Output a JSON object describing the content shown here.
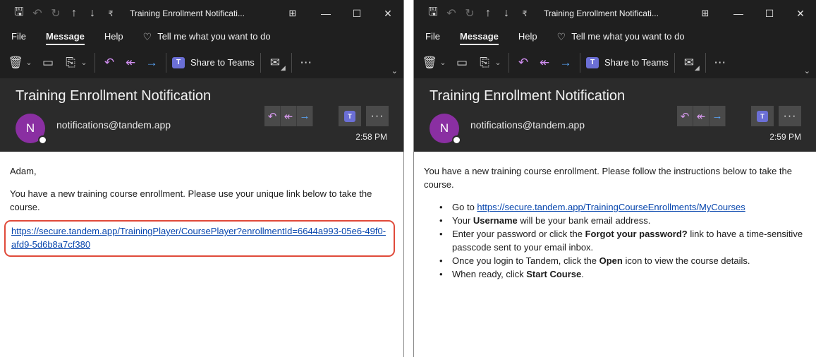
{
  "left": {
    "window_title": "Training Enrollment Notificati...",
    "menu": {
      "file": "File",
      "message": "Message",
      "help": "Help",
      "tellme": "Tell me what you want to do"
    },
    "ribbon": {
      "share_teams": "Share to Teams"
    },
    "subject": "Training Enrollment Notification",
    "avatar_initial": "N",
    "sender": "notifications@tandem.app",
    "time": "2:58 PM",
    "body": {
      "greeting": "Adam,",
      "paragraph": "You have a new training course enrollment. Please use your unique link below to take the course.",
      "link": "https://secure.tandem.app/TrainingPlayer/CoursePlayer?enrollmentId=6644a993-05e6-49f0-afd9-5d6b8a7cf380"
    }
  },
  "right": {
    "window_title": "Training Enrollment Notificati...",
    "menu": {
      "file": "File",
      "message": "Message",
      "help": "Help",
      "tellme": "Tell me what you want to do"
    },
    "ribbon": {
      "share_teams": "Share to Teams"
    },
    "subject": "Training Enrollment Notification",
    "avatar_initial": "N",
    "sender": "notifications@tandem.app",
    "time": "2:59 PM",
    "body": {
      "paragraph": "You have a new training course enrollment. Please follow the instructions below to take the course.",
      "step1_prefix": "Go to ",
      "step1_link": "https://secure.tandem.app/TrainingCourseEnrollments/MyCourses",
      "step2_prefix": "Your ",
      "step2_bold": "Username",
      "step2_suffix": " will be your bank email address.",
      "step3_prefix": "Enter your password or click the ",
      "step3_bold": "Forgot your password?",
      "step3_suffix": " link to have a time-sensitive passcode sent to your email inbox.",
      "step4_prefix": "Once you login to Tandem, click the ",
      "step4_bold": "Open",
      "step4_suffix": " icon to view the course details.",
      "step5_prefix": "When ready, click ",
      "step5_bold": "Start Course",
      "step5_suffix": "."
    }
  },
  "icons": {
    "save": "save-icon",
    "undo": "undo-icon",
    "redo": "redo-icon",
    "up": "up-arrow-icon",
    "down": "down-arrow-icon",
    "customize": "customize-qat-icon",
    "ribbon_display": "ribbon-display-options-icon",
    "minimize": "minimize-icon",
    "maximize": "maximize-icon",
    "close": "close-icon",
    "delete": "delete-icon",
    "archive": "archive-icon",
    "move": "move-icon",
    "reply": "reply-icon",
    "reply_all": "reply-all-icon",
    "forward": "forward-icon",
    "teams": "teams-icon",
    "envelope": "envelope-icon",
    "more": "more-icon"
  },
  "colors": {
    "chrome": "#1f1f1f",
    "header": "#2b2b2b",
    "avatar": "#8a2fa2",
    "link": "#0645ad",
    "highlight": "#e04a3a",
    "teams": "#6b6fd6"
  }
}
